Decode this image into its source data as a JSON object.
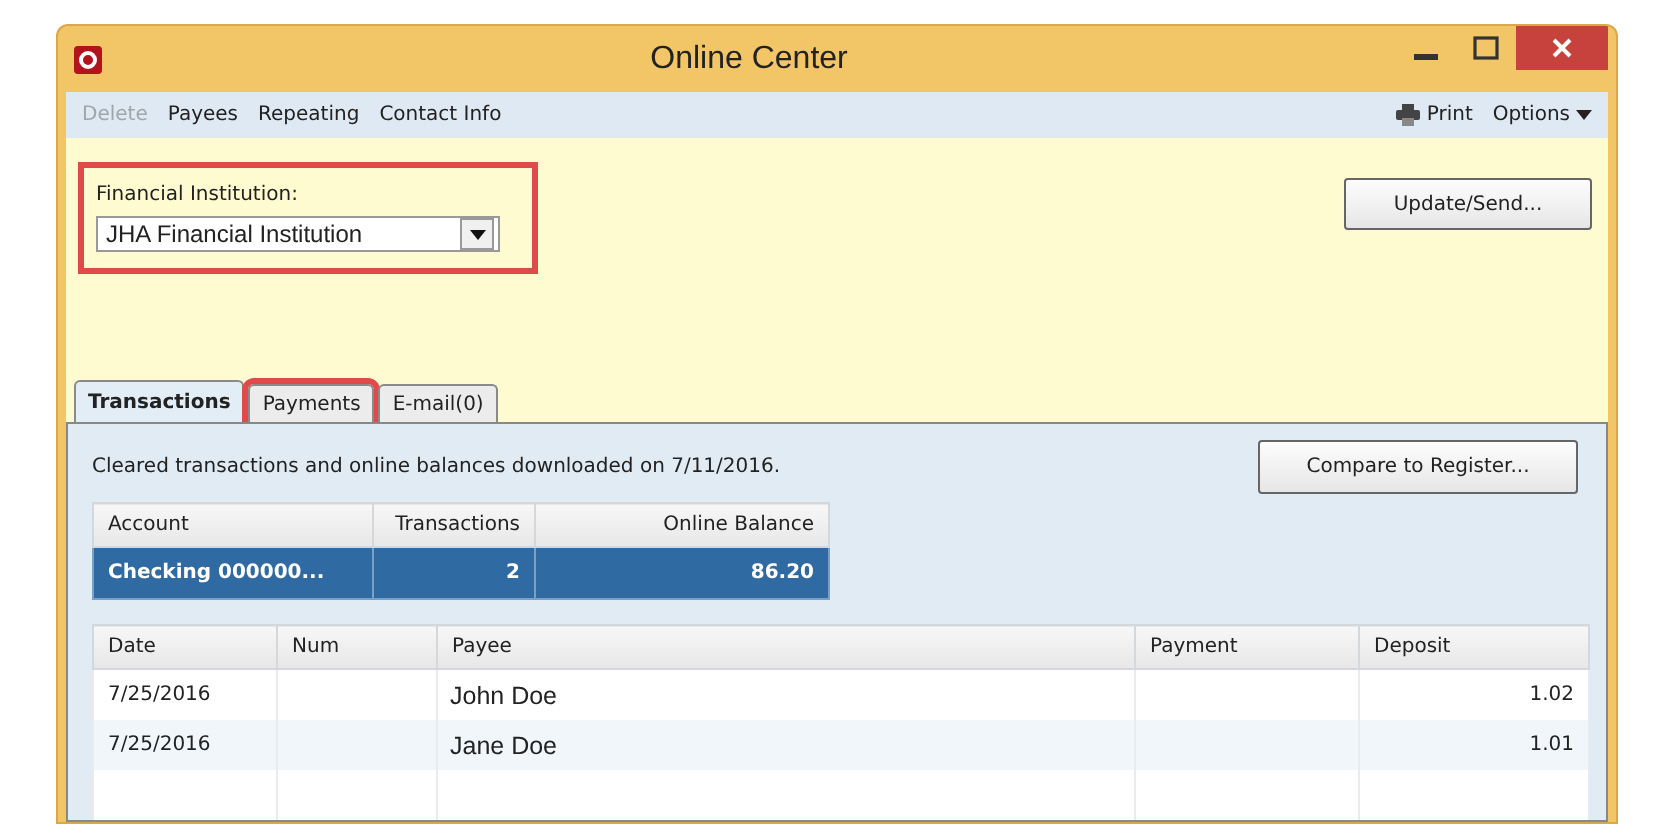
{
  "window": {
    "title": "Online Center"
  },
  "toolbar": {
    "items": [
      {
        "label": "Delete",
        "disabled": true
      },
      {
        "label": "Payees",
        "disabled": false
      },
      {
        "label": "Repeating",
        "disabled": false
      },
      {
        "label": "Contact Info",
        "disabled": false
      }
    ],
    "print": "Print",
    "options": "Options"
  },
  "institution": {
    "label": "Financial Institution:",
    "value": "JHA Financial Institution",
    "highlighted": true
  },
  "update_button": "Update/Send...",
  "tabs": [
    {
      "label": "Transactions",
      "selected": true,
      "highlighted": false
    },
    {
      "label": "Payments",
      "selected": false,
      "highlighted": true
    },
    {
      "label": "E-mail(0)",
      "selected": false,
      "highlighted": false
    }
  ],
  "status_text": "Cleared transactions and online balances downloaded on 7/11/2016.",
  "compare_button": "Compare to Register...",
  "accounts": {
    "columns": [
      "Account",
      "Transactions",
      "Online Balance"
    ],
    "rows": [
      {
        "cells": [
          "Checking 000000...",
          "2",
          "86.20"
        ],
        "selected": true
      }
    ]
  },
  "transactions": {
    "columns": [
      "Date",
      "Num",
      "Payee",
      "Payment",
      "Deposit"
    ],
    "rows": [
      {
        "cells": [
          "7/25/2016",
          "",
          "John Doe",
          "",
          "1.02"
        ]
      },
      {
        "cells": [
          "7/25/2016",
          "",
          "Jane Doe",
          "",
          "1.01"
        ]
      }
    ]
  }
}
